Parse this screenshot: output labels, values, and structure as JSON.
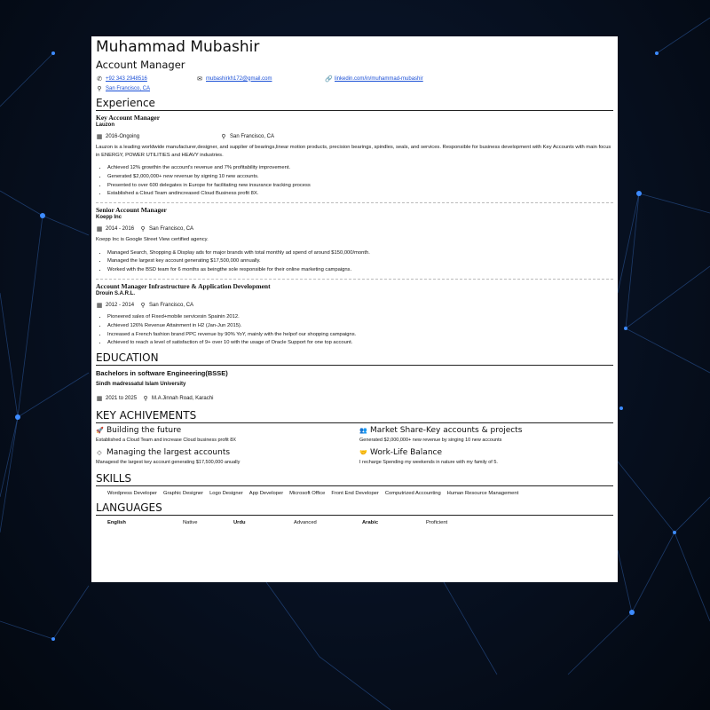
{
  "header": {
    "name": "Muhammad Mubashir",
    "role": "Account Manager",
    "phone": "+92 343 2948516",
    "email": "mubashirkh172@gmail.com",
    "linkedin": "linkedin.com/in/muhammad-mubashir",
    "location": "San Francisco, CA"
  },
  "sections": {
    "experience": "Experience",
    "education": "EDUCATION",
    "achievements": "KEY ACHIVEMENTS",
    "skills": "SKILLS",
    "languages": "LANGUAGES"
  },
  "experience": [
    {
      "title": "Key Account Manager",
      "company": "Lauzon",
      "dates": "2016-Ongoing",
      "location": "San Francisco, CA",
      "description": "Lauzon is a leading worldwide manufacturer,designer, and supplier of bearings,linear motion products, precision bearings, spindles, seals, and services. Responsible for business development with Key Accounts with main focus in ENERGY, POWER UTILITIES and HEAVY industries.",
      "achievements": [
        "Achieved 12% growthin the account's revenue and 7% profitability improvement.",
        "Generated $2,000,000+ new revenue by signing 10 new accounts.",
        "Presented to over 600 delegates in Europe for facilitating new insurance tracking process",
        "Established a Cloud Team andincreased Cloud Business profit 8X."
      ]
    },
    {
      "title": "Senior Account Manager",
      "company": "Koepp Inc",
      "dates": "2014 - 2016",
      "location": "San Francisco, CA",
      "description": "Koepp Inc is Google Street View certified agency.",
      "achievements": [
        "Managed Search, Shopping & Display ads for major brands with total monthly ad spend of around $150,000/month.",
        "Managed the largest key account generating $17,500,000 annually.",
        "Worked with the BSD team for 6 months as beingthe sole responsible for their online marketing campaigns."
      ]
    },
    {
      "title": "Account Manager Infrastructure & Application Development",
      "company": "Drouin S.A.R.L.",
      "dates": "2012 - 2014",
      "location": "San Francisco, CA",
      "achievements": [
        "Pioneered sales of Fixed+mobile servicesin Spainin 2012.",
        "Achieved 126% Revenue Attainment in H2 (Jan-Jun 2015).",
        "Increased a French fashion brand PPC revenue by 90% YoY, mainly with the helpof our shopping campaigns.",
        "Achieved to reach a level of satisfaction of 9+ over 10 with the usage of Oracle Support for one top account."
      ]
    }
  ],
  "education": {
    "degree": "Bachelors in software Engineering(BSSE)",
    "school": "Sindh madressatul Islam University",
    "dates": "2021 to 2025",
    "location": "M.A Jinnah Road, Karachi"
  },
  "key_achievements": [
    {
      "icon": "rocket-icon",
      "title": "Building the future",
      "desc": "Established a Cloud Team and increase Cloud business profit 8X"
    },
    {
      "icon": "chart-people-icon",
      "title": "Market Share-Key accounts & projects",
      "desc": "Generated $2,000,000+ new revenue by singing 10 new accounts"
    },
    {
      "icon": "diamond-icon",
      "title": "Managing the largest accounts",
      "desc": "Managesd the largest key account generating $17,500,000 anually"
    },
    {
      "icon": "handshake-icon",
      "title": "Work-Life Balance",
      "desc": "I recharge Spending my weekends in nature with my family of 5."
    }
  ],
  "skills": [
    "Wordpress Developer",
    "Graphic Designer",
    "Logo Designer",
    "App Developer",
    "Microsoft Office",
    "Front End Developer",
    "Computrized Accounting",
    "Human Resource Management"
  ],
  "languages": [
    {
      "name": "English",
      "level": "Native"
    },
    {
      "name": "Urdu",
      "level": "Advanced"
    },
    {
      "name": "Arabic",
      "level": "Proficient"
    }
  ],
  "colors": {
    "background": "#071020",
    "link": "#1a4fd6",
    "node": "#3d8bff"
  }
}
